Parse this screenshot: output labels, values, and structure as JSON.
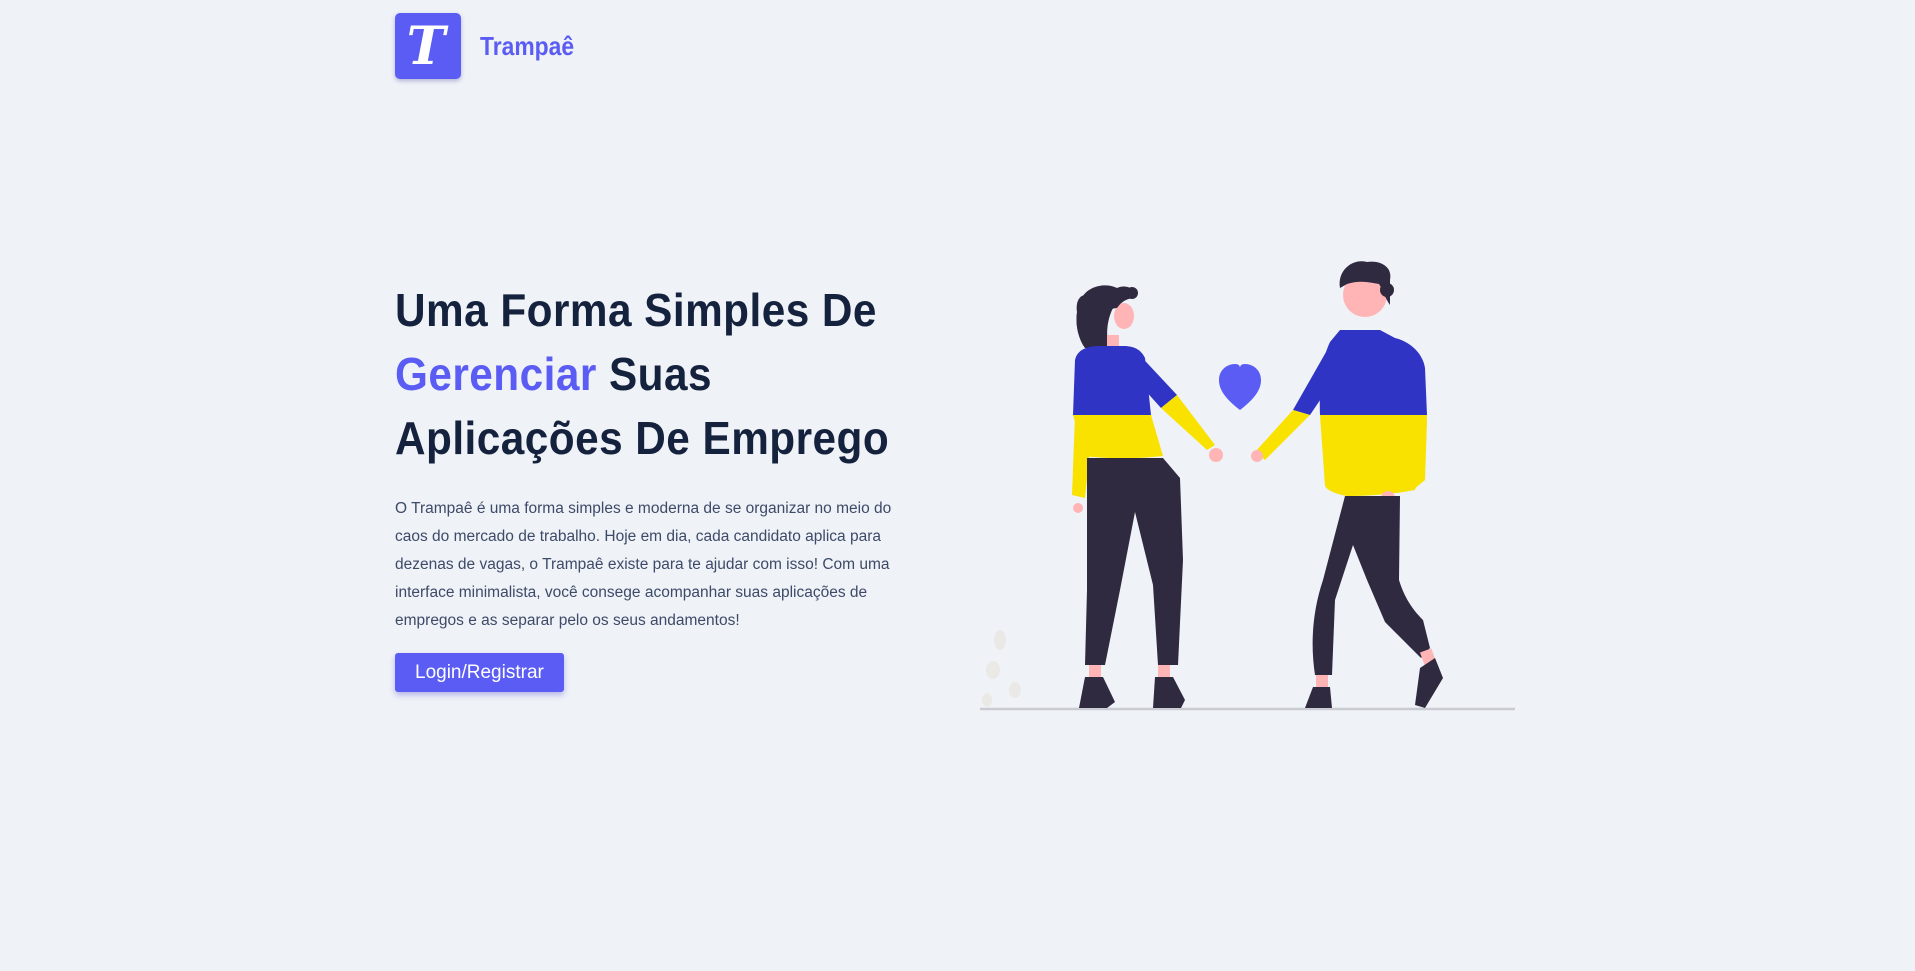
{
  "header": {
    "logo_letter": "T",
    "brand_name": "Trampaê"
  },
  "hero": {
    "headline_line1": "Uma Forma Simples De",
    "headline_accent": "Gerenciar",
    "headline_line2_rest": " Suas",
    "headline_line3": "Aplicações De Emprego",
    "description": "O Trampaê é uma forma simples e moderna de se organizar no meio do caos do mercado de trabalho. Hoje em dia, cada candidato aplica para dezenas de vagas, o Trampaê existe para te ajudar com isso! Com uma interface minimalista, você consege acompanhar suas aplicações de empregos e as separar pelo os seus andamentos!",
    "cta_label": "Login/Registrar"
  },
  "colors": {
    "background": "#eff2f7",
    "accent": "#5a5cf3",
    "heading": "#15223d",
    "body_text": "#3d4a68",
    "sweater_blue": "#3034c4",
    "sweater_yellow": "#f9e200",
    "pants": "#2f2a3f",
    "skin": "#ffb5b5"
  },
  "illustration": {
    "subject": "couple holding hands with heart",
    "icon": "heart-icon"
  }
}
